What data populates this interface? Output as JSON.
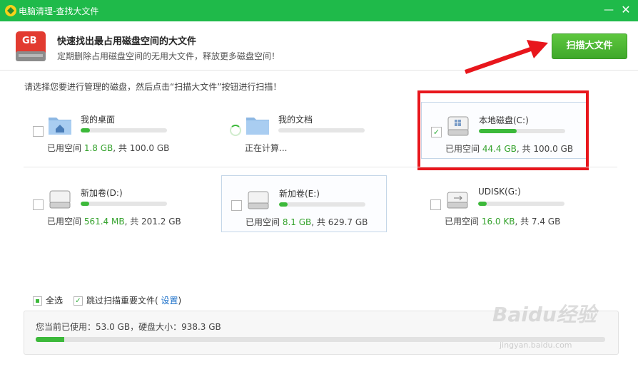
{
  "window": {
    "title": "电脑清理-查找大文件",
    "minimize": "—",
    "close": "✕"
  },
  "header": {
    "badge": "GB",
    "title": "快速找出最占用磁盘空间的大文件",
    "subtitle": "定期删除占用磁盘空间的无用大文件，释放更多磁盘空间！",
    "scan_button": "扫描大文件"
  },
  "instruction": "请选择您要进行管理的磁盘，然后点击“扫描大文件”按钮进行扫描！",
  "drives": [
    {
      "name": "我的桌面",
      "icon": "desktop-folder-icon",
      "checked": false,
      "used_prefix": "已用空间 ",
      "used": "1.8 GB",
      "total_suffix": ", 共 100.0 GB",
      "fill": 0.11
    },
    {
      "name": "我的文档",
      "icon": "documents-folder-icon",
      "checked": false,
      "status": "正在计算...",
      "fill": 0.0
    },
    {
      "name": "本地磁盘(C:)",
      "icon": "windows-drive-icon",
      "checked": true,
      "used_prefix": "已用空间 ",
      "used": "44.4 GB",
      "total_suffix": ", 共 100.0 GB",
      "fill": 0.44
    },
    {
      "name": "新加卷(D:)",
      "icon": "hard-drive-icon",
      "checked": false,
      "used_prefix": "已用空间 ",
      "used": "561.4 MB",
      "total_suffix": ", 共 201.2 GB",
      "fill": 0.1
    },
    {
      "name": "新加卷(E:)",
      "icon": "hard-drive-icon",
      "checked": false,
      "used_prefix": "已用空间 ",
      "used": "8.1 GB",
      "total_suffix": ", 共 629.7 GB",
      "fill": 0.1
    },
    {
      "name": "UDISK(G:)",
      "icon": "usb-drive-icon",
      "checked": false,
      "used_prefix": "已用空间 ",
      "used": "16.0 KB",
      "total_suffix": ", 共 7.4 GB",
      "fill": 0.1
    }
  ],
  "options": {
    "select_all": "全选",
    "skip_label": "跳过扫描重要文件(",
    "settings_link": "设置",
    "skip_close": ")"
  },
  "summary": {
    "text": "您当前已使用：53.0 GB，硬盘大小：938.3 GB",
    "fill": 0.05
  },
  "watermark": {
    "brand": "Baidu经验",
    "url": "jingyan.baidu.com"
  },
  "colors": {
    "brand_green": "#1fba4a",
    "bar_green": "#3cb93a",
    "annotation_red": "#e8161c",
    "link_blue": "#1a6fc9"
  }
}
